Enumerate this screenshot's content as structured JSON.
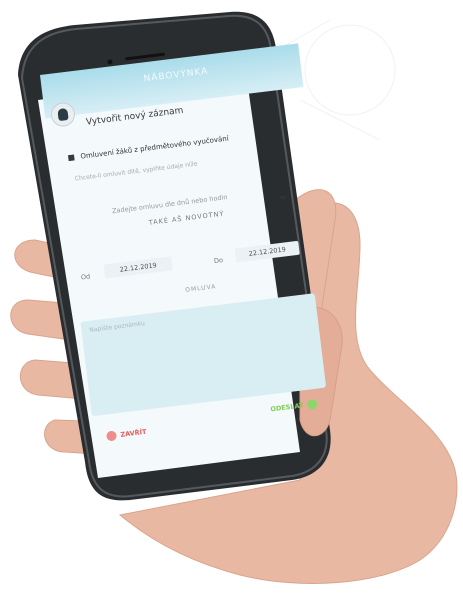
{
  "app": {
    "title": "NÁBOVÝNKA"
  },
  "form": {
    "title": "Vytvořit nový záznam",
    "checkbox_label": "Omluvení žáků z předmětového vyučování",
    "hint": "Chcete-li omluvit dítě, vyplňte údaje níže",
    "select_label": "Zadejte omluvu dle dnů nebo hodin",
    "select_value": "TAKÉ AŠ NOVOTNÝ",
    "date_from_label": "Od",
    "date_from": "22.12.2019",
    "date_to_label": "Do",
    "date_to": "22.12.2019",
    "sub_label": "OMLUVA",
    "note_placeholder": "Napište poznámku",
    "cancel_label": "ZAVŘÍT",
    "send_label": "ODESLAT"
  },
  "colors": {
    "header": "#a9dcea",
    "note_bg": "#d8eef3",
    "cancel": "#e35d5d",
    "send": "#7dcf4f"
  }
}
